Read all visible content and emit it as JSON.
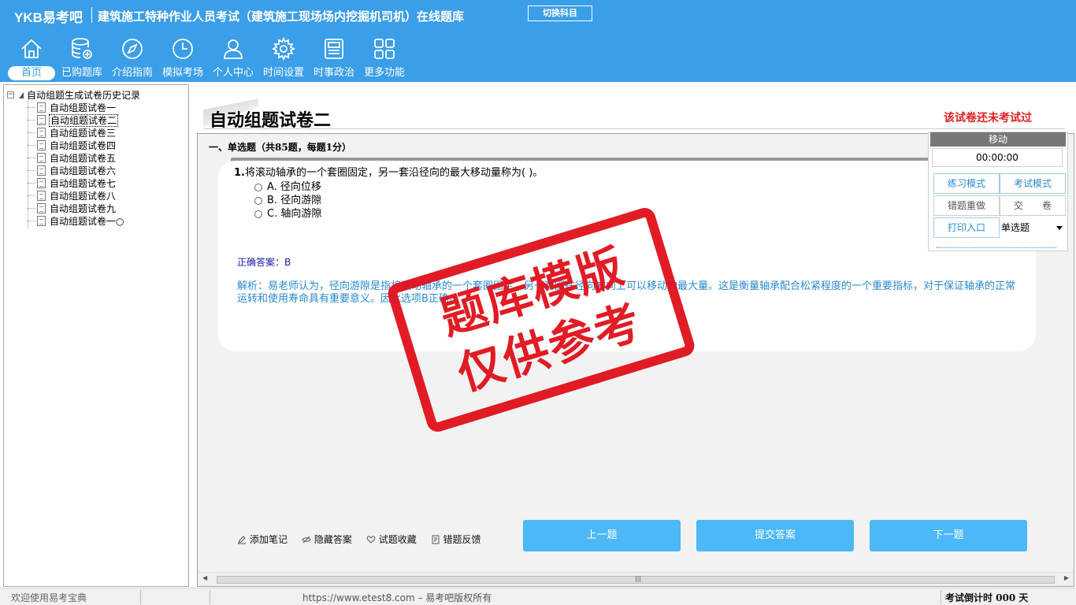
{
  "app": {
    "logo": "YKB易考吧",
    "title": "建筑施工特种作业人员考试（建筑施工现场场内挖掘机司机）在线题库",
    "switch_subject": "切换科目"
  },
  "nav": [
    {
      "label": "首页",
      "icon": "home-icon"
    },
    {
      "label": "已购题库",
      "icon": "database-icon"
    },
    {
      "label": "介绍指南",
      "icon": "compass-icon"
    },
    {
      "label": "模拟考场",
      "icon": "clock-icon"
    },
    {
      "label": "个人中心",
      "icon": "user-icon"
    },
    {
      "label": "时间设置",
      "icon": "gear-icon"
    },
    {
      "label": "时事政治",
      "icon": "newspaper-icon"
    },
    {
      "label": "更多功能",
      "icon": "grid-icon"
    }
  ],
  "tree": {
    "root": "自动组题生成试卷历史记录",
    "items": [
      "自动组题试卷一",
      "自动组题试卷二",
      "自动组题试卷三",
      "自动组题试卷四",
      "自动组题试卷五",
      "自动组题试卷六",
      "自动组题试卷七",
      "自动组题试卷八",
      "自动组题试卷九",
      "自动组题试卷一○"
    ],
    "selected_index": 1
  },
  "paper": {
    "title": "自动组题试卷二",
    "status": "该试卷还未考试过",
    "section": "一、单选题（共85题，每题1分）"
  },
  "question": {
    "number": "1.",
    "text": "将滚动轴承的一个套圈固定，另一套沿径向的最大移动量称为( )。",
    "options": [
      "A. 径向位移",
      "B. 径向游隙",
      "C. 轴向游隙"
    ],
    "answer": "正确答案：B",
    "analysis": "解析：易老师认为，径向游隙是指将滚动轴承的一个套圈固定，另一套圈在径向方向上可以移动的最大量。这是衡量轴承配合松紧程度的一个重要指标，对于保证轴承的正常运转和使用寿命具有重要意义。因此选项B正确。"
  },
  "tools": [
    "添加笔记",
    "隐藏答案",
    "试题收藏",
    "错题反馈"
  ],
  "buttons": {
    "prev": "上一题",
    "submit": "提交答案",
    "next": "下一题"
  },
  "control": {
    "header": "移动",
    "timer": "00:00:00",
    "practice": "练习模式",
    "exam": "考试模式",
    "redo": "错题重做",
    "hand_in": "交　　卷",
    "print": "打印入口",
    "type_select": "单选题"
  },
  "stamp": {
    "line1": "题库模版",
    "line2": "仅供参考"
  },
  "status": {
    "welcome": "欢迎使用易考宝典",
    "copyright": "https://www.etest8.com – 易考吧版权所有",
    "countdown": "考试倒计时 000 天"
  },
  "colors": {
    "header_bg": "#3a9ee8",
    "button_bg": "#4cb8f5",
    "stamp_red": "#e0101a",
    "analysis_blue": "#2a8ad0"
  }
}
